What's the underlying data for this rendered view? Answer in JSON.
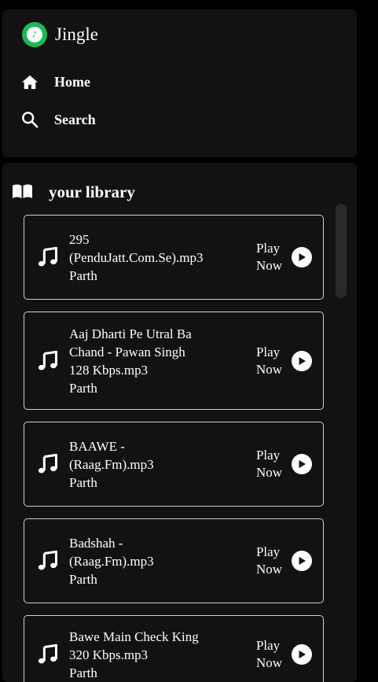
{
  "brand": {
    "name": "Jingle",
    "accent": "#1db954"
  },
  "nav": {
    "home_label": "Home",
    "search_label": "Search"
  },
  "library": {
    "title": "your library",
    "play_label_line1": "Play",
    "play_label_line2": "Now",
    "songs": [
      {
        "title_lines": [
          "295",
          "(PenduJatt.Com.Se).mp3"
        ],
        "artist": "Parth"
      },
      {
        "title_lines": [
          "Aaj Dharti Pe Utral Ba",
          "Chand - Pawan Singh",
          "128 Kbps.mp3"
        ],
        "artist": "Parth"
      },
      {
        "title_lines": [
          "BAAWE -",
          "(Raag.Fm).mp3"
        ],
        "artist": "Parth"
      },
      {
        "title_lines": [
          "Badshah -",
          "(Raag.Fm).mp3"
        ],
        "artist": "Parth"
      },
      {
        "title_lines": [
          "Bawe Main Check King",
          "320 Kbps.mp3"
        ],
        "artist": "Parth"
      }
    ]
  }
}
